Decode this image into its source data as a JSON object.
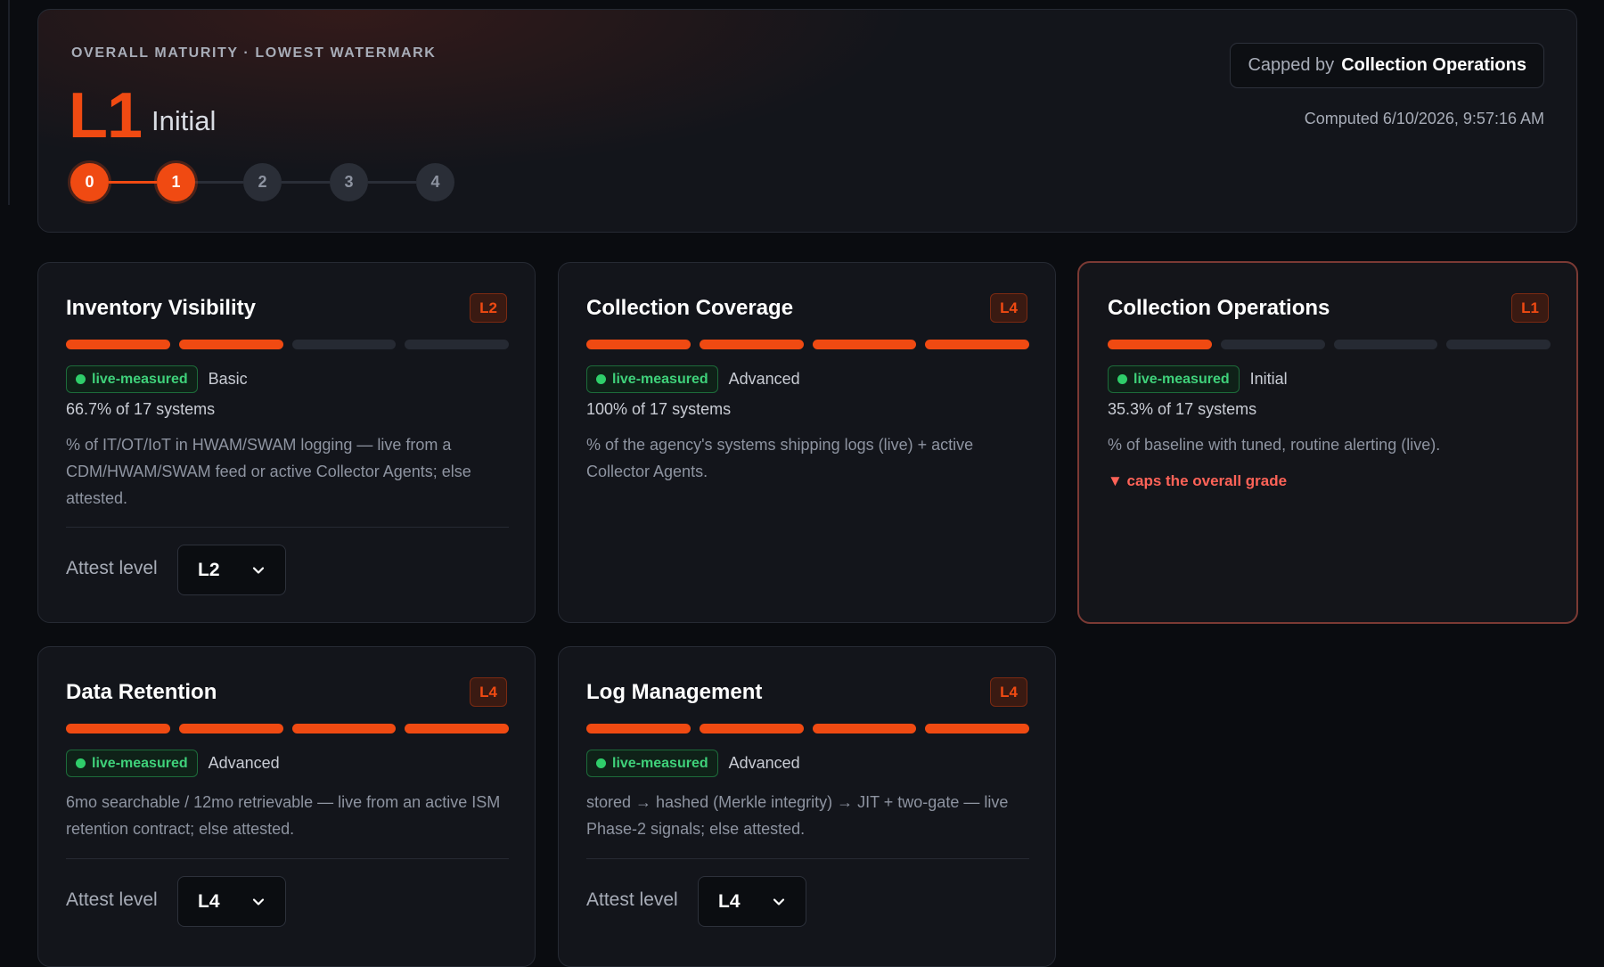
{
  "header": {
    "overline": "OVERALL MATURITY · LOWEST WATERMARK",
    "level": "L1",
    "level_name": "Initial",
    "steps": [
      "0",
      "1",
      "2",
      "3",
      "4"
    ],
    "current_step": 1,
    "capped_prefix": "Capped by",
    "capped_by": "Collection Operations",
    "computed": "Computed 6/10/2026, 9:57:16 AM"
  },
  "colors": {
    "accent": "#f04a12",
    "live_green": "#3fd17a",
    "cap_red": "#ff6358"
  },
  "cards": [
    {
      "title": "Inventory Visibility",
      "badge": "L2",
      "filled_segments": 2,
      "live_label": "live-measured",
      "tier": "Basic",
      "coverage": "66.7% of 17 systems",
      "description": "% of IT/OT/IoT in HWAM/SWAM logging — live from a CDM/HWAM/SWAM feed or active Collector Agents; else attested.",
      "attest_label": "Attest level",
      "attest_value": "L2"
    },
    {
      "title": "Collection Coverage",
      "badge": "L4",
      "filled_segments": 4,
      "live_label": "live-measured",
      "tier": "Advanced",
      "coverage": "100% of 17 systems",
      "description": "% of the agency's systems shipping logs (live) + active Collector Agents."
    },
    {
      "title": "Collection Operations",
      "badge": "L1",
      "filled_segments": 1,
      "live_label": "live-measured",
      "tier": "Initial",
      "coverage": "35.3% of 17 systems",
      "description": "% of baseline with tuned, routine alerting (live).",
      "caps_note": "▼ caps the overall grade"
    },
    {
      "title": "Data Retention",
      "badge": "L4",
      "filled_segments": 4,
      "live_label": "live-measured",
      "tier": "Advanced",
      "description": "6mo searchable / 12mo retrievable — live from an active ISM retention contract; else attested.",
      "attest_label": "Attest level",
      "attest_value": "L4"
    },
    {
      "title": "Log Management",
      "badge": "L4",
      "filled_segments": 4,
      "live_label": "live-measured",
      "tier": "Advanced",
      "description": "stored → hashed (Merkle integrity) → JIT + two-gate — live Phase-2 signals; else attested.",
      "attest_label": "Attest level",
      "attest_value": "L4"
    }
  ]
}
